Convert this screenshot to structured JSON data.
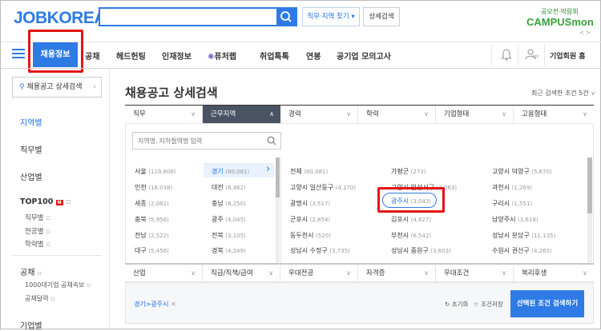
{
  "header": {
    "logo": "JOBKOREA",
    "search_placeholder": "",
    "region_button": "직무·지역 찾기",
    "detail_search": "상세검색",
    "promo_top": "공모전·박람회",
    "promo_logo": "CAMPUSmon",
    "promo_pager": "< >"
  },
  "nav": {
    "items": [
      "채용정보",
      "공채",
      "헤드헌팅",
      "인재정보",
      "퓨처랩",
      "취업톡톡",
      "연봉",
      "공기업 모의고사"
    ],
    "my_label": "MY",
    "corp_label": "기업회원 홈"
  },
  "sidebar": {
    "search_btn": "채용공고 상세검색",
    "items": [
      "지역별",
      "직무별",
      "산업별",
      "TOP100"
    ],
    "top100_badge": "N",
    "top100_sub": [
      "직무별",
      "전공별",
      "학력별"
    ],
    "gongchae": "공채",
    "gongchae_sub": [
      "1000대기업 공채속보",
      "공채달력"
    ],
    "last": "기업별"
  },
  "main": {
    "title": "채용공고 상세검색",
    "recent": "최근 검색한 조건 5건",
    "tabs": [
      "직무",
      "근무지역",
      "경력",
      "학력",
      "기업형태",
      "고용형태"
    ],
    "region_input_placeholder": "지역명, 지하철역명 입력",
    "regions": [
      {
        "name": "서울",
        "count": "(119,808)"
      },
      {
        "name": "인천",
        "count": "(18,038)"
      },
      {
        "name": "세종",
        "count": "(2,082)"
      },
      {
        "name": "충북",
        "count": "(5,956)"
      },
      {
        "name": "전남",
        "count": "(2,522)"
      },
      {
        "name": "대구",
        "count": "(5,456)"
      }
    ],
    "regions2": [
      {
        "name": "경기",
        "count": "(80,081)"
      },
      {
        "name": "대전",
        "count": "(6,462)"
      },
      {
        "name": "충남",
        "count": "(8,250)"
      },
      {
        "name": "광주",
        "count": "(4,045)"
      },
      {
        "name": "전북",
        "count": "(3,105)"
      },
      {
        "name": "경북",
        "count": "(4,249)"
      }
    ],
    "cities_col1": [
      {
        "name": "전체",
        "count": "(80,081)"
      },
      {
        "name": "고양시 일산동구",
        "count": "(4,170)"
      },
      {
        "name": "광명시",
        "count": "(3,517)"
      },
      {
        "name": "군포시",
        "count": "(2,854)"
      },
      {
        "name": "동두천시",
        "count": "(520)"
      },
      {
        "name": "성남시 수정구",
        "count": "(3,735)"
      }
    ],
    "cities_col2": [
      {
        "name": "가평군",
        "count": "(273)"
      },
      {
        "name": "고양시 일산서구",
        "count": "(3,063)"
      },
      {
        "name": "광주시",
        "count": "(3,043)"
      },
      {
        "name": "김포시",
        "count": "(4,827)"
      },
      {
        "name": "부천시",
        "count": "(6,542)"
      },
      {
        "name": "성남시 중원구",
        "count": "(3,603)"
      }
    ],
    "cities_col3": [
      {
        "name": "고양시 덕양구",
        "count": "(5,670)"
      },
      {
        "name": "과천시",
        "count": "(1,269)"
      },
      {
        "name": "구리시",
        "count": "(1,551)"
      },
      {
        "name": "남양주시",
        "count": "(3,618)"
      },
      {
        "name": "성남시 분당구",
        "count": "(11,135)"
      },
      {
        "name": "수원시 권선구",
        "count": "(4,265)"
      }
    ],
    "bottom_tabs": [
      "산업",
      "직급/직책/급여",
      "우대전공",
      "자격증",
      "우대조건",
      "복리후생"
    ],
    "selected_chip": "경기>광주시",
    "reset": "초기화",
    "save": "조건저장",
    "submit": "선택된 조건 검색하기"
  },
  "colors": {
    "accent": "#2e7be6",
    "highlight": "#e51414",
    "tab_dark": "#4a5364"
  }
}
